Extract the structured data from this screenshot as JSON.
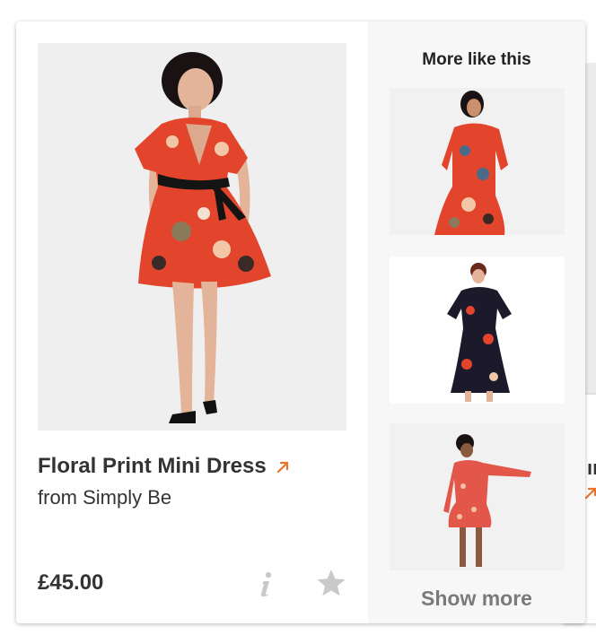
{
  "product": {
    "title": "Floral Print Mini Dress",
    "merchant": "from Simply Be",
    "price": "£45.00",
    "image": "model-in-red-floral-mini-dress-image"
  },
  "related": {
    "title": "More like this",
    "items": [
      {
        "image": "model-in-red-floral-maxi-wrap-dress-image"
      },
      {
        "image": "model-in-black-floral-midi-dress-image"
      },
      {
        "image": "model-in-red-floral-flutter-sleeve-dress-image"
      }
    ],
    "show_more_label": "Show more"
  },
  "next_card_peek": {
    "title_fragment": "ır"
  },
  "colors": {
    "accent_arrow": "#e8732a",
    "icon_gray": "#c9c9c9",
    "dress_red": "#e2452c"
  },
  "icons": [
    "external-link-arrow-icon",
    "info-icon",
    "star-icon"
  ]
}
